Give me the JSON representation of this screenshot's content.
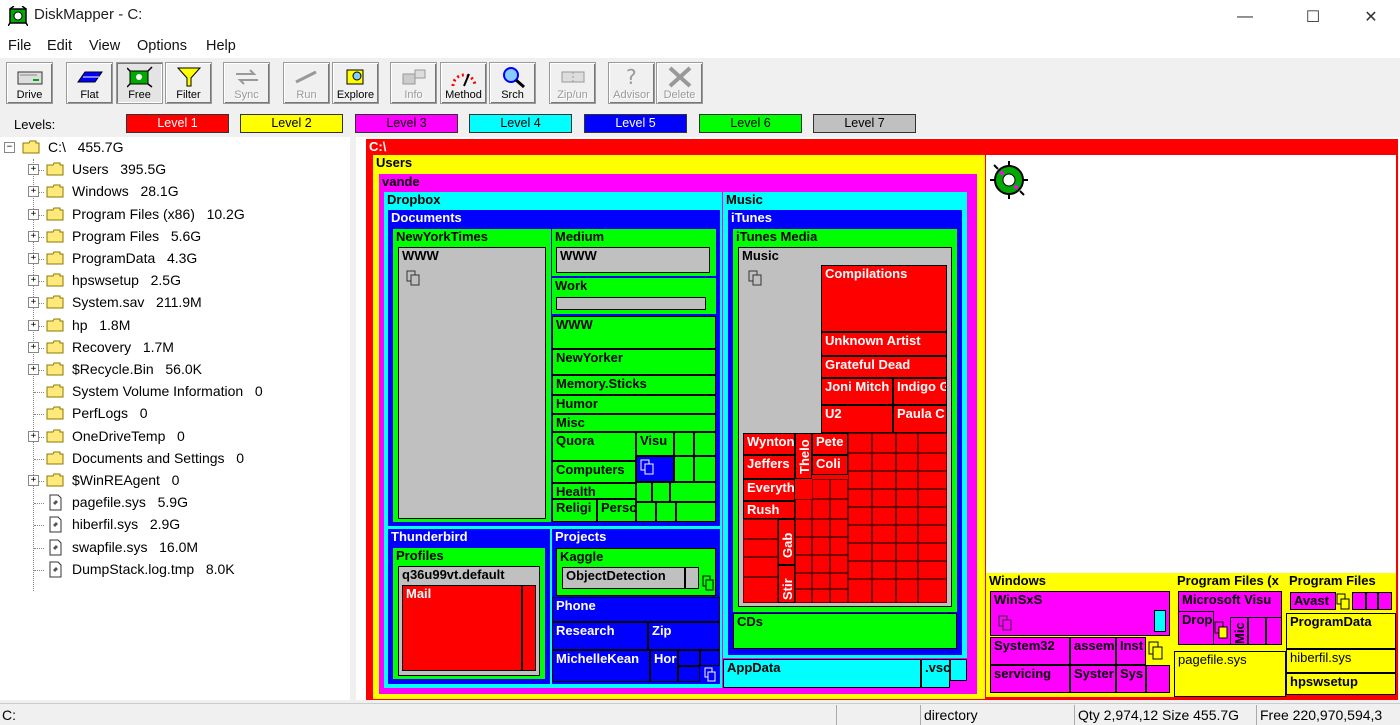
{
  "window": {
    "title": "DiskMapper - C:",
    "controls": {
      "minimize": "—",
      "maximize": "☐",
      "close": "✕"
    }
  },
  "menu": [
    "File",
    "Edit",
    "View",
    "Options",
    "Help"
  ],
  "toolbar": [
    {
      "label": "Drive",
      "icon": "drive-icon",
      "enabled": true
    },
    {
      "label": "Flat",
      "icon": "flat-icon",
      "enabled": true
    },
    {
      "label": "Free",
      "icon": "free-icon",
      "enabled": true,
      "pressed": true
    },
    {
      "label": "Filter",
      "icon": "funnel-icon",
      "enabled": true
    },
    {
      "label": "Sync",
      "icon": "sync-icon",
      "enabled": false
    },
    {
      "label": "Run",
      "icon": "run-icon",
      "enabled": false
    },
    {
      "label": "Explore",
      "icon": "explore-icon",
      "enabled": true
    },
    {
      "label": "Info",
      "icon": "info-icon",
      "enabled": false
    },
    {
      "label": "Method",
      "icon": "method-icon",
      "enabled": true
    },
    {
      "label": "Srch",
      "icon": "magnifier-icon",
      "enabled": true
    },
    {
      "label": "Zip/un",
      "icon": "zip-icon",
      "enabled": false
    },
    {
      "label": "Advisor",
      "icon": "question-icon",
      "enabled": false
    },
    {
      "label": "Delete",
      "icon": "delete-icon",
      "enabled": false
    }
  ],
  "levels": {
    "label": "Levels:",
    "items": [
      {
        "label": "Level 1",
        "color": "#ff0000",
        "text_color": "#ffffff"
      },
      {
        "label": "Level 2",
        "color": "#ffff00",
        "text_color": "#000000"
      },
      {
        "label": "Level 3",
        "color": "#ff00ff",
        "text_color": "#000000"
      },
      {
        "label": "Level 4",
        "color": "#00ffff",
        "text_color": "#000000"
      },
      {
        "label": "Level 5",
        "color": "#0000ff",
        "text_color": "#ffffff"
      },
      {
        "label": "Level 6",
        "color": "#00ff00",
        "text_color": "#000000"
      },
      {
        "label": "Level 7",
        "color": "#c0c0c0",
        "text_color": "#000000"
      }
    ]
  },
  "tree": {
    "root": {
      "name": "C:\\",
      "size": "455.7G"
    },
    "items": [
      {
        "name": "Users",
        "size": "395.5G",
        "type": "folder",
        "expandable": true
      },
      {
        "name": "Windows",
        "size": "28.1G",
        "type": "folder",
        "expandable": true
      },
      {
        "name": "Program Files (x86)",
        "size": "10.2G",
        "type": "folder",
        "expandable": true
      },
      {
        "name": "Program Files",
        "size": "5.6G",
        "type": "folder",
        "expandable": true
      },
      {
        "name": "ProgramData",
        "size": "4.3G",
        "type": "folder",
        "expandable": true
      },
      {
        "name": "hpswsetup",
        "size": "2.5G",
        "type": "folder",
        "expandable": true
      },
      {
        "name": "System.sav",
        "size": "211.9M",
        "type": "folder",
        "expandable": true
      },
      {
        "name": "hp",
        "size": "1.8M",
        "type": "folder",
        "expandable": true
      },
      {
        "name": "Recovery",
        "size": "1.7M",
        "type": "folder",
        "expandable": true
      },
      {
        "name": "$Recycle.Bin",
        "size": "56.0K",
        "type": "folder",
        "expandable": true
      },
      {
        "name": "System Volume Information",
        "size": "0",
        "type": "folder",
        "expandable": false
      },
      {
        "name": "PerfLogs",
        "size": "0",
        "type": "folder",
        "expandable": false
      },
      {
        "name": "OneDriveTemp",
        "size": "0",
        "type": "folder",
        "expandable": true
      },
      {
        "name": "Documents and Settings",
        "size": "0",
        "type": "folder",
        "expandable": false
      },
      {
        "name": "$WinREAgent",
        "size": "0",
        "type": "folder",
        "expandable": true
      },
      {
        "name": "pagefile.sys",
        "size": "5.9G",
        "type": "file",
        "expandable": false
      },
      {
        "name": "hiberfil.sys",
        "size": "2.9G",
        "type": "file",
        "expandable": false
      },
      {
        "name": "swapfile.sys",
        "size": "16.0M",
        "type": "file",
        "expandable": false
      },
      {
        "name": "DumpStack.log.tmp",
        "size": "8.0K",
        "type": "file",
        "expandable": false
      }
    ]
  },
  "treemap": {
    "root": "C:\\",
    "users": "Users",
    "vande": "vande",
    "dropbox": "Dropbox",
    "documents": "Documents",
    "nyt": "NewYorkTimes",
    "www": "WWW",
    "medium": "Medium",
    "work": "Work",
    "www2": "WWW",
    "newyorker": "NewYorker",
    "memory": "Memory.Sticks",
    "humor": "Humor",
    "misc": "Misc",
    "quora": "Quora",
    "visual": "Visu",
    "computers": "Computers",
    "health": "Health",
    "religion": "Religi",
    "personal": "Perso",
    "thunderbird": "Thunderbird",
    "profiles": "Profiles",
    "profile_default": "q36u99vt.default",
    "mail": "Mail",
    "projects": "Projects",
    "kaggle": "Kaggle",
    "objectdetection": "ObjectDetection",
    "phone": "Phone",
    "research": "Research",
    "zip": "Zip",
    "michellekean": "MichelleKean",
    "hor": "Hor",
    "music": "Music",
    "itunes": "iTunes",
    "itunes_media": "iTunes Media",
    "music2": "Music",
    "compilations": "Compilations",
    "unknown_artist": "Unknown Artist",
    "grateful_dead": "Grateful Dead",
    "joni": "Joni Mitch",
    "indigo": "Indigo G",
    "u2": "U2",
    "paula": "Paula C",
    "wynton": "Wynton",
    "thelonious": "Thelo",
    "pete": "Pete",
    "jefferson": "Jeffers",
    "coli": "Coli",
    "everything": "Everyth",
    "rush": "Rush",
    "gab": "Gab",
    "stir": "Stir",
    "cds": "CDs",
    "appdata": "AppData",
    "vscode": ".vsc",
    "windows": "Windows",
    "winsxs": "WinSxS",
    "system32": "System32",
    "assembly": "assem",
    "installer": "Inst",
    "servicing": "servicing",
    "systemapps": "Syster",
    "syswow": "Sys",
    "pfx86": "Program Files (x",
    "ms_visual": "Microsoft Visu",
    "dropbox_pf": "Drop",
    "mic": "Mic",
    "pf": "Program Files",
    "avast": "Avast",
    "programdata": "ProgramData",
    "pagefile": "pagefile.sys",
    "hiberfil": "hiberfil.sys",
    "hpswsetup": "hpswsetup"
  },
  "status": {
    "path": "C:",
    "type": "directory",
    "qty": "Qty 2,974,12",
    "size": "Size 455.7G",
    "free": "Free 220,970,594,3"
  }
}
